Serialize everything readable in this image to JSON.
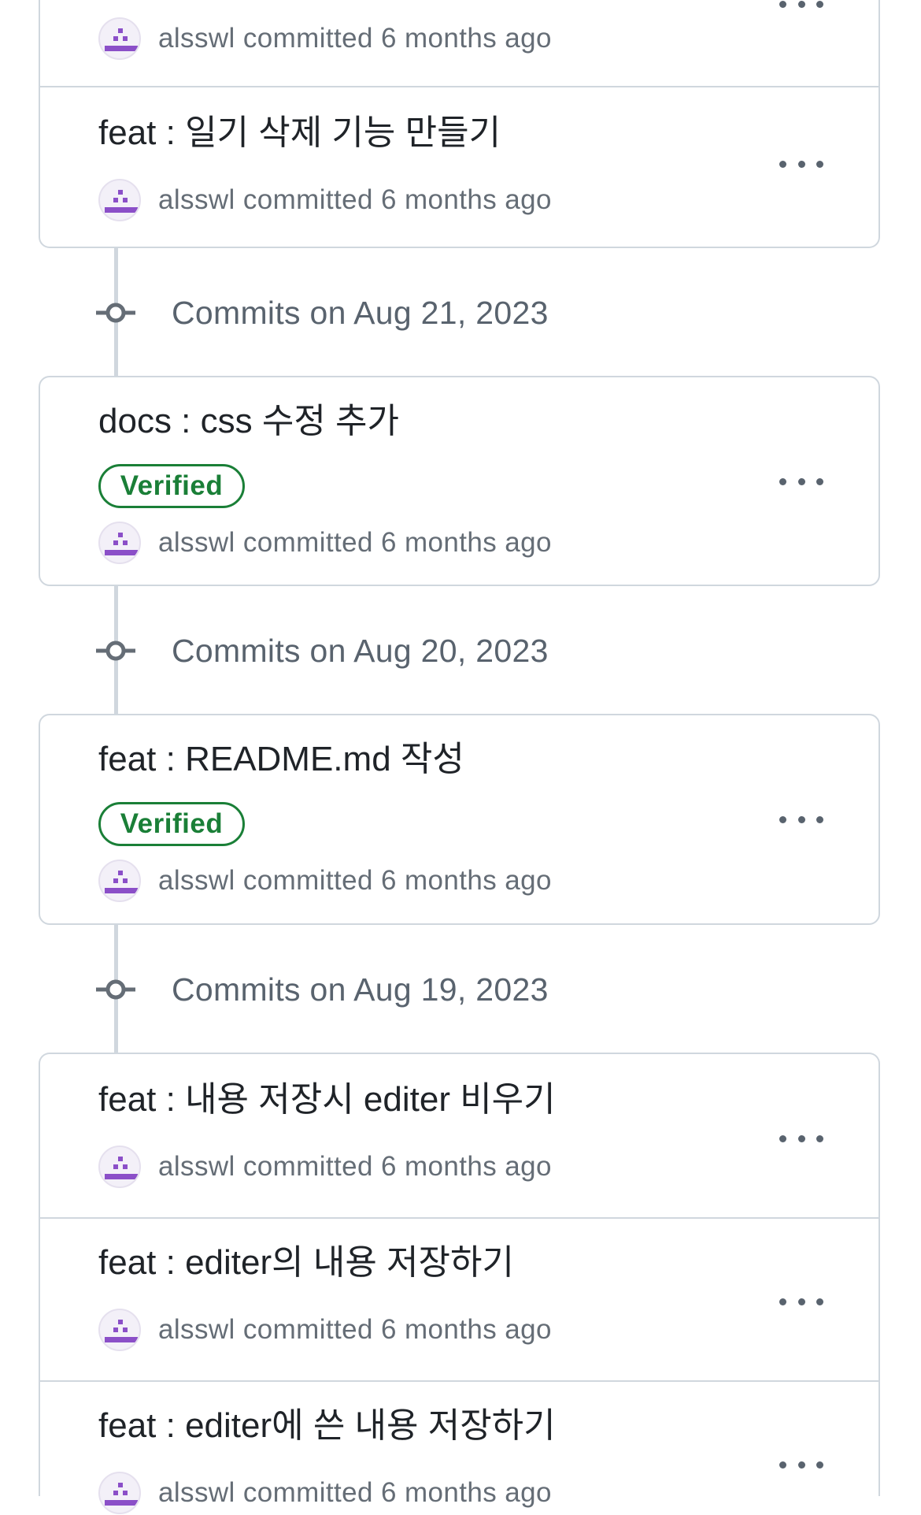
{
  "author": "alsswl",
  "meta_text": "alsswl committed 6 months ago",
  "badge_label": "Verified",
  "colors": {
    "verified": "#1a7f37",
    "border": "#d0d7de",
    "muted_text": "#656d76",
    "avatar_purple": "#8b4fc8"
  },
  "icons": {
    "avatar": "identicon-avatar",
    "more": "kebab-horizontal-icon",
    "commit_node": "git-commit-icon"
  },
  "groups": [
    {
      "header": null,
      "commits": [
        {
          "title": "",
          "verified": false,
          "meta": "alsswl committed 6 months ago"
        },
        {
          "title": "feat : 일기 삭제 기능 만들기",
          "verified": false,
          "meta": "alsswl committed 6 months ago"
        }
      ]
    },
    {
      "header": "Commits on Aug 21, 2023",
      "commits": [
        {
          "title": "docs : css 수정 추가",
          "verified": true,
          "meta": "alsswl committed 6 months ago"
        }
      ]
    },
    {
      "header": "Commits on Aug 20, 2023",
      "commits": [
        {
          "title": "feat : README.md 작성",
          "verified": true,
          "meta": "alsswl committed 6 months ago"
        }
      ]
    },
    {
      "header": "Commits on Aug 19, 2023",
      "commits": [
        {
          "title": "feat : 내용 저장시 editer 비우기",
          "verified": false,
          "meta": "alsswl committed 6 months ago"
        },
        {
          "title": "feat : editer의 내용 저장하기",
          "verified": false,
          "meta": "alsswl committed 6 months ago"
        },
        {
          "title": "feat : editer에 쓴 내용 저장하기",
          "verified": false,
          "meta": "alsswl committed 6 months ago"
        }
      ]
    }
  ]
}
